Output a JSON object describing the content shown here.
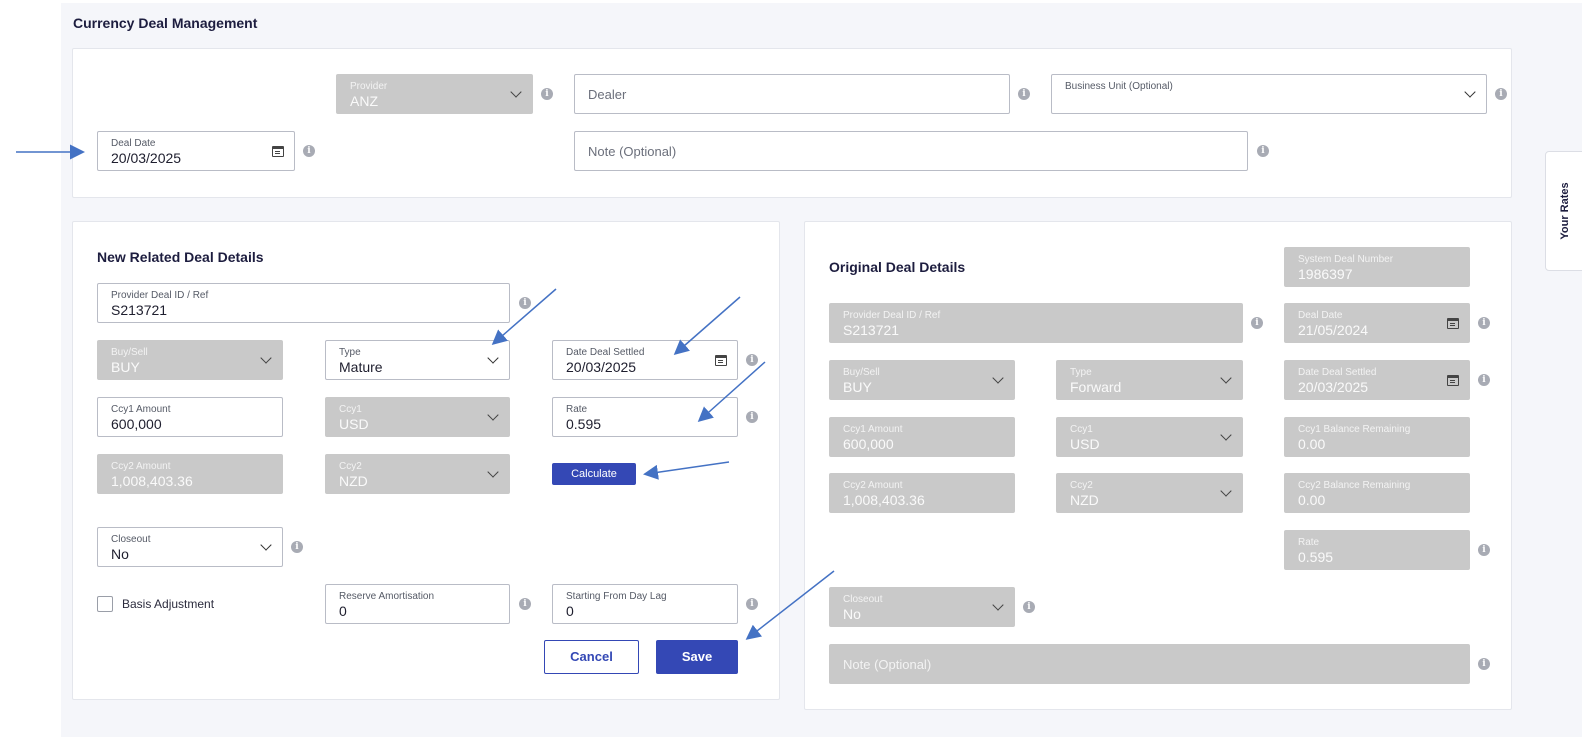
{
  "page": {
    "title": "Currency Deal Management"
  },
  "top": {
    "provider": {
      "label": "Provider",
      "value": "ANZ"
    },
    "dealer": {
      "placeholder": "Dealer"
    },
    "business_unit": {
      "label": "Business Unit (Optional)"
    },
    "deal_date": {
      "label": "Deal Date",
      "value": "20/03/2025"
    },
    "note": {
      "placeholder": "Note (Optional)"
    }
  },
  "new_deal": {
    "title": "New Related Deal Details",
    "provider_ref": {
      "label": "Provider Deal ID / Ref",
      "value": "S213721"
    },
    "buy_sell": {
      "label": "Buy/Sell",
      "value": "BUY"
    },
    "type": {
      "label": "Type",
      "value": "Mature"
    },
    "date_settled": {
      "label": "Date Deal Settled",
      "value": "20/03/2025"
    },
    "ccy1_amount": {
      "label": "Ccy1 Amount",
      "value": "600,000"
    },
    "ccy1": {
      "label": "Ccy1",
      "value": "USD"
    },
    "rate": {
      "label": "Rate",
      "value": "0.595"
    },
    "ccy2_amount": {
      "label": "Ccy2 Amount",
      "value": "1,008,403.36"
    },
    "ccy2": {
      "label": "Ccy2",
      "value": "NZD"
    },
    "calculate_label": "Calculate",
    "closeout": {
      "label": "Closeout",
      "value": "No"
    },
    "basis_adjustment_label": "Basis Adjustment",
    "reserve_amortisation": {
      "label": "Reserve Amortisation",
      "value": "0"
    },
    "starting_from_day_lag": {
      "label": "Starting From Day Lag",
      "value": "0"
    },
    "cancel_label": "Cancel",
    "save_label": "Save"
  },
  "original_deal": {
    "title": "Original Deal Details",
    "system_deal_number": {
      "label": "System Deal Number",
      "value": "1986397"
    },
    "provider_ref": {
      "label": "Provider Deal ID / Ref",
      "value": "S213721"
    },
    "deal_date": {
      "label": "Deal Date",
      "value": "21/05/2024"
    },
    "buy_sell": {
      "label": "Buy/Sell",
      "value": "BUY"
    },
    "type": {
      "label": "Type",
      "value": "Forward"
    },
    "date_settled": {
      "label": "Date Deal Settled",
      "value": "20/03/2025"
    },
    "ccy1_amount": {
      "label": "Ccy1 Amount",
      "value": "600,000"
    },
    "ccy1": {
      "label": "Ccy1",
      "value": "USD"
    },
    "ccy1_balance": {
      "label": "Ccy1 Balance Remaining",
      "value": "0.00"
    },
    "ccy2_amount": {
      "label": "Ccy2 Amount",
      "value": "1,008,403.36"
    },
    "ccy2": {
      "label": "Ccy2",
      "value": "NZD"
    },
    "ccy2_balance": {
      "label": "Ccy2 Balance Remaining",
      "value": "0.00"
    },
    "rate": {
      "label": "Rate",
      "value": "0.595"
    },
    "closeout": {
      "label": "Closeout",
      "value": "No"
    },
    "note": {
      "placeholder": "Note (Optional)"
    }
  },
  "side_tab": {
    "label": "Your Rates"
  },
  "info_glyph": "i",
  "colors": {
    "primary": "#3448b5",
    "arrow": "#4472c4",
    "readonly": "#c9c9c9"
  }
}
